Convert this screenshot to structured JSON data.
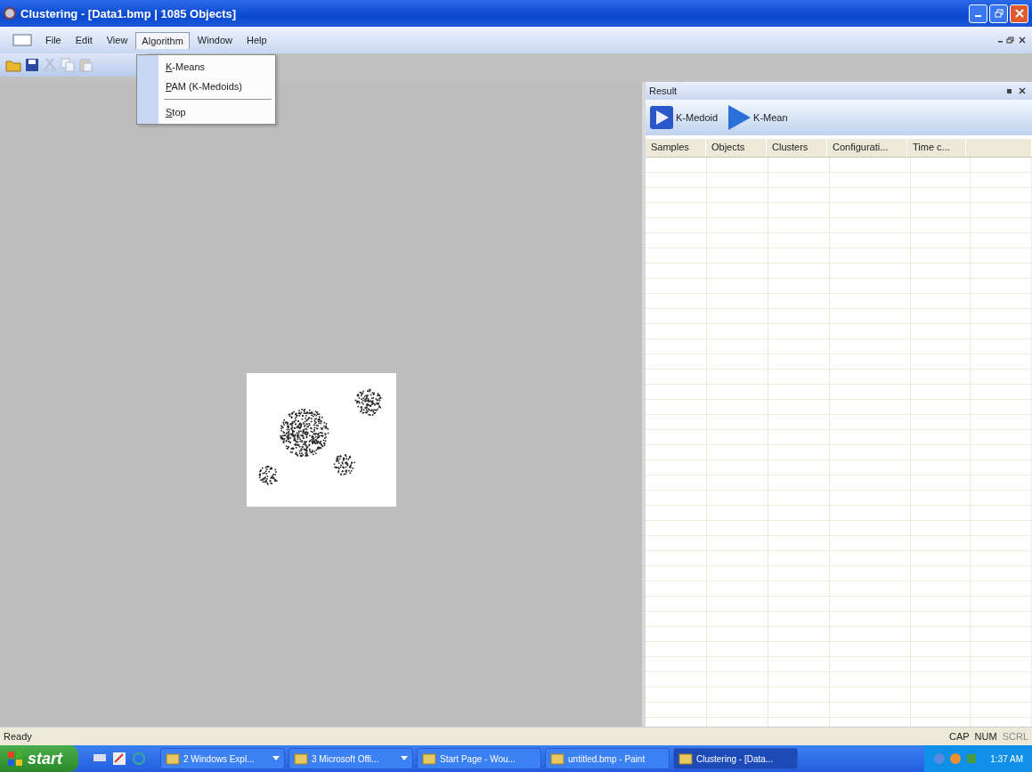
{
  "window": {
    "title": "Clustering - [Data1.bmp | 1085 Objects]"
  },
  "menu": [
    {
      "label": "File",
      "selected": false
    },
    {
      "label": "Edit",
      "selected": false
    },
    {
      "label": "View",
      "selected": false
    },
    {
      "label": "Algorithm",
      "selected": true
    },
    {
      "label": "Window",
      "selected": false
    },
    {
      "label": "Help",
      "selected": false
    }
  ],
  "dropdown": [
    {
      "kind": "item",
      "label": "K-Means"
    },
    {
      "kind": "item",
      "label": "PAM (K-Medoids)"
    },
    {
      "kind": "separator"
    },
    {
      "kind": "item",
      "label": "Stop"
    }
  ],
  "result_panel": {
    "title": "Result",
    "buttons": [
      {
        "label": "K-Medoid",
        "kind": "boxed"
      },
      {
        "label": "K-Mean",
        "kind": "plain"
      }
    ],
    "columns": [
      "Samples",
      "Objects",
      "Clusters",
      "Configurati...",
      "Time c..."
    ]
  },
  "status_bar": {
    "text": "Ready",
    "indicators": [
      {
        "label": "CAP",
        "disabled": false
      },
      {
        "label": "NUM",
        "disabled": false
      },
      {
        "label": "SCRL",
        "disabled": true
      }
    ]
  },
  "taskbar": {
    "start": "start",
    "tasks": [
      {
        "label": "2 Windows Expl...",
        "selected": false,
        "group": true
      },
      {
        "label": "3 Microsoft Offi...",
        "selected": false,
        "group": true
      },
      {
        "label": "Start Page - Wou...",
        "selected": false,
        "group": false
      },
      {
        "label": "untitled.bmp - Paint",
        "selected": false,
        "group": false
      },
      {
        "label": "Clustering - [Data...",
        "selected": true,
        "group": false
      }
    ],
    "clock": "1:37 AM"
  }
}
